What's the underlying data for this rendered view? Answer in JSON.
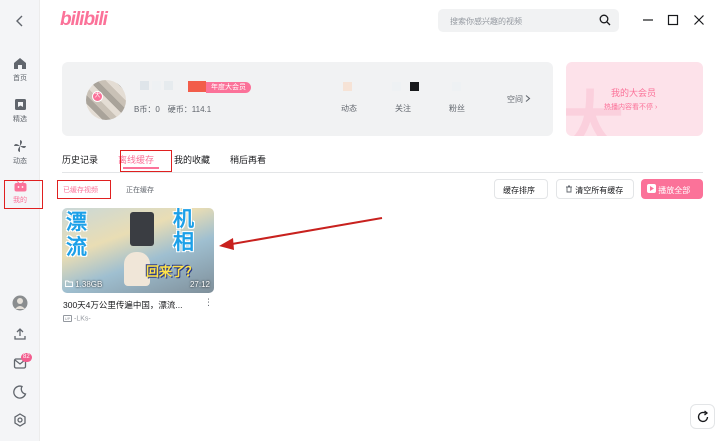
{
  "app": {
    "logo": "bilibili"
  },
  "search": {
    "placeholder": "搜索你感兴趣的视频"
  },
  "sidebar": {
    "items": [
      {
        "label": "首页",
        "icon": "home-icon"
      },
      {
        "label": "精选",
        "icon": "featured-icon"
      },
      {
        "label": "动态",
        "icon": "pinwheel-icon"
      },
      {
        "label": "我的",
        "icon": "tv-icon",
        "active": true
      }
    ],
    "message_badge": "82"
  },
  "profile": {
    "vip_tag": "年度大会员",
    "badge": "大",
    "b_coin": "B币：0",
    "coin": "硬币：114.1",
    "stats": [
      {
        "label": "动态"
      },
      {
        "label": "关注"
      },
      {
        "label": "粉丝"
      }
    ],
    "space_link": "空间"
  },
  "vip_card": {
    "title": "我的大会员",
    "subtitle": "热播内容看不停"
  },
  "tabs": [
    {
      "label": "历史记录"
    },
    {
      "label": "离线缓存",
      "active": true
    },
    {
      "label": "我的收藏"
    },
    {
      "label": "稍后再看"
    }
  ],
  "subtabs": {
    "done": "已缓存视频",
    "doing": "正在缓存"
  },
  "actions": {
    "sort": "缓存排序",
    "clear": "清空所有缓存",
    "play_all": "播放全部"
  },
  "video": {
    "thumb_text": {
      "a": "漂",
      "b": "流",
      "c": "机",
      "d": "相",
      "e": "回来了？"
    },
    "size": "1.38GB",
    "duration": "27:12",
    "title": "300天4万公里传遍中国，漂流...",
    "uploader": "-LKs-"
  },
  "colors": {
    "accent": "#fb7299",
    "annotation": "#e02020"
  }
}
